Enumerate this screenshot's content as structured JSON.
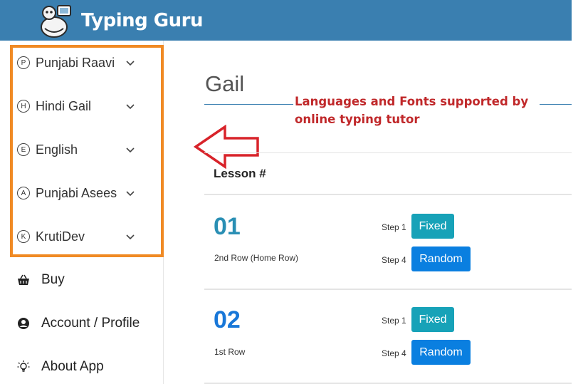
{
  "header": {
    "title": "Typing Guru",
    "logo_icon": "typing-mascot-icon",
    "bg_color": "#3a7fb0"
  },
  "sidebar": {
    "languages": [
      {
        "letter": "P",
        "label": "Punjabi Raavi"
      },
      {
        "letter": "H",
        "label": "Hindi Gail"
      },
      {
        "letter": "E",
        "label": "English"
      },
      {
        "letter": "A",
        "label": "Punjabi Asees"
      },
      {
        "letter": "K",
        "label": "KrutiDev"
      }
    ],
    "menu": [
      {
        "icon": "basket-icon",
        "label": "Buy"
      },
      {
        "icon": "user-circle-icon",
        "label": "Account / Profile"
      },
      {
        "icon": "lightbulb-icon",
        "label": "About App"
      }
    ],
    "highlight_color": "#f08a24"
  },
  "main": {
    "title": "Gail",
    "annotation": "Languages and Fonts supported by online typing tutor",
    "annotation_color": "#c0282a",
    "table_header": {
      "lesson": "Lesson #"
    },
    "lessons": [
      {
        "number": "01",
        "description": "2nd Row (Home Row)",
        "number_color": "#2a8fb4",
        "steps": [
          {
            "label": "Step 1",
            "button": "Fixed"
          },
          {
            "label": "Step 4",
            "button": "Random"
          }
        ]
      },
      {
        "number": "02",
        "description": "1st Row",
        "number_color": "#1877d8",
        "steps": [
          {
            "label": "Step 1",
            "button": "Fixed"
          },
          {
            "label": "Step 4",
            "button": "Random"
          }
        ]
      }
    ]
  }
}
